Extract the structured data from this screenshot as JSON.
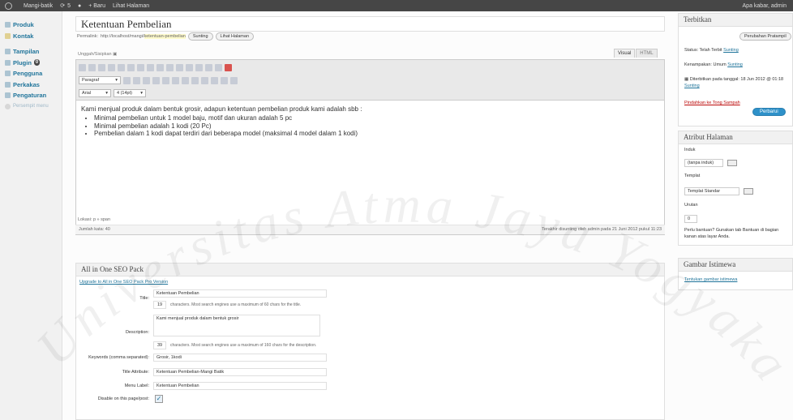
{
  "adminbar": {
    "site": "Mangi-batik",
    "comments": "5",
    "new_label": "+ Baru",
    "view_label": "Lihat Halaman",
    "greeting": "Apa kabar, admin"
  },
  "sidebar": {
    "items": [
      {
        "label": "Produk"
      },
      {
        "label": "Kontak"
      },
      {
        "label": "Tampilan"
      },
      {
        "label": "Plugin",
        "badge": "0"
      },
      {
        "label": "Pengguna"
      },
      {
        "label": "Perkakas"
      },
      {
        "label": "Pengaturan"
      },
      {
        "label": "Persempit menu"
      }
    ]
  },
  "page": {
    "title": "Ketentuan Pembelian",
    "permalink_label": "Permalink:",
    "permalink_url": "http://localhost/mangi/",
    "permalink_slug": "ketentuan-pembelian",
    "edit_label": "Sunting",
    "view_page_label": "Lihat Halaman",
    "upload_label": "Unggah/Sisipkan"
  },
  "editor": {
    "tab_visual": "Visual",
    "tab_html": "HTML",
    "format_select": "Paragraf",
    "font_select": "Arial",
    "size_select": "4 (14pt)",
    "intro": "Kami menjual produk dalam bentuk grosir, adapun ketentuan pembelian produk kami adalah sbb :",
    "bullets": [
      "Minimal pembelian untuk 1 model baju, motif dan ukuran adalah 5 pc",
      "Minimal pembelian adalah 1 kodi (20 Pc)",
      "Pembelian dalam 1 kodi dapat terdiri dari beberapa model (maksimal 4 model dalam 1 kodi)"
    ],
    "path": "Lokasi: p » span",
    "wordcount": "Jumlah kata: 40",
    "last_edit": "Terakhir disunting oleh admin pada 21 Juni 2012 pukul 11:23"
  },
  "seo": {
    "title": "All in One SEO Pack",
    "upgrade_link": "Upgrade to All in One SEO Pack Pro Version",
    "title_label": "Title:",
    "title_value": "Ketentuan Pembelian",
    "title_count": "19",
    "title_note": "characters. Most search engines use a maximum of 60 chars for the title.",
    "desc_label": "Description:",
    "desc_value": "Kami menjual produk dalam bentuk grosir",
    "desc_count": "39",
    "desc_note": "characters. Most search engines use a maximum of 160 chars for the description.",
    "keywords_label": "Keywords (comma separated):",
    "keywords_value": "Grosir, 1kodi",
    "title_attr_label": "Title Attribute:",
    "title_attr_value": "Ketentuan Pembelian-Mangi Batik",
    "menu_label_label": "Menu Label:",
    "menu_label_value": "Ketentuan Pembelian",
    "disable_label": "Disable on this page/post:"
  },
  "publish": {
    "title": "Terbitkan",
    "preview_btn": "Perubahan Pratampil",
    "status": "Status: Telah Terbit",
    "status_edit": "Sunting",
    "visibility": "Kenampakan: Umum",
    "visibility_edit": "Sunting",
    "published_on": "Diterbitkan pada tanggal: 18 Jun 2012 @ 01:18",
    "published_edit": "Sunting",
    "trash_link": "Pindahkan ke Tong Sampah",
    "update_btn": "Perbarui"
  },
  "attributes": {
    "title": "Atribut Halaman",
    "parent_label": "Induk",
    "parent_value": "(tanpa induk)",
    "template_label": "Templat",
    "template_value": "Templat Standar",
    "order_label": "Urutan",
    "order_value": "0",
    "help": "Perlu bantuan? Gunakan tab Bantuan di bagian kanan atas layar Anda."
  },
  "featured": {
    "title": "Gambar Istimewa",
    "link": "Tentukan gambar istimewa"
  },
  "watermark": {
    "text": "Universitas Atma Jaya Yogyakarta"
  },
  "colors": {
    "accent": "#21759b",
    "button_blue": "#2e91c9",
    "adminbar": "#464646",
    "trash": "#bc0b0b"
  }
}
